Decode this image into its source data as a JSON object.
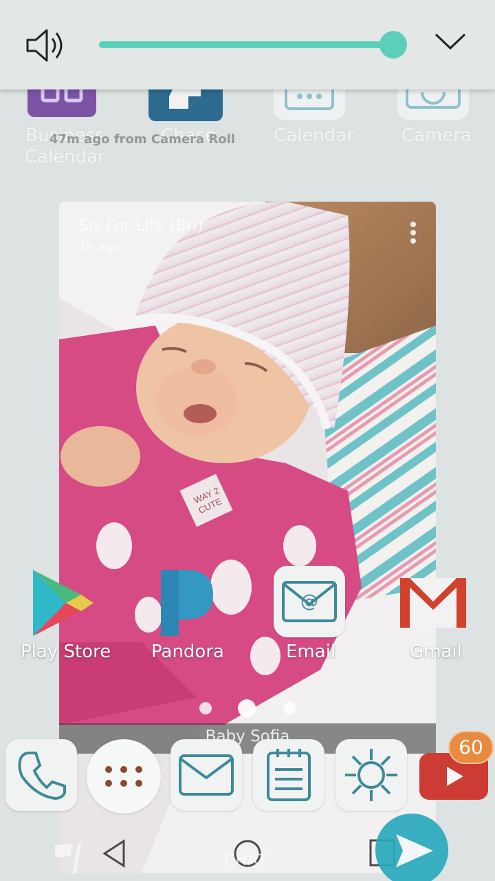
{
  "volume": {
    "level_percent": 100
  },
  "top_apps": [
    {
      "label_line1": "Business",
      "label_line2": "Calendar",
      "color": "#7b54a6"
    },
    {
      "label_line1": "Chase",
      "label_line2": "",
      "color": "#2d6b8e"
    },
    {
      "label_line1": "Calendar",
      "label_line2": "",
      "color": "#f1f3f3"
    },
    {
      "label_line1": "Camera",
      "label_line2": "",
      "color": "#f1f3f3"
    }
  ],
  "ghost_text": "47m ago from Camera Roll",
  "photo_card": {
    "title": "Sis For Life (Bri)",
    "time": "1h ago",
    "caption": "Baby Sofia",
    "onesie_text": "WAY 2 CUTE"
  },
  "home_apps": [
    {
      "label": "Play Store"
    },
    {
      "label": "Pandora"
    },
    {
      "label": "Email"
    },
    {
      "label": "Gmail"
    }
  ],
  "page_indicator": {
    "count": 3,
    "active": 2
  },
  "dock": {
    "youtube_badge": "60"
  },
  "nav": {
    "chat_label": "CHAT"
  },
  "colors": {
    "accent": "#5ccfbb",
    "icon_teal": "#3d8a9a",
    "pandora_blue": "#3498c5",
    "gmail_red": "#d1412e",
    "youtube_red": "#cc3c34",
    "badge_orange": "#e98a3e",
    "send_teal": "#29a9bd"
  }
}
